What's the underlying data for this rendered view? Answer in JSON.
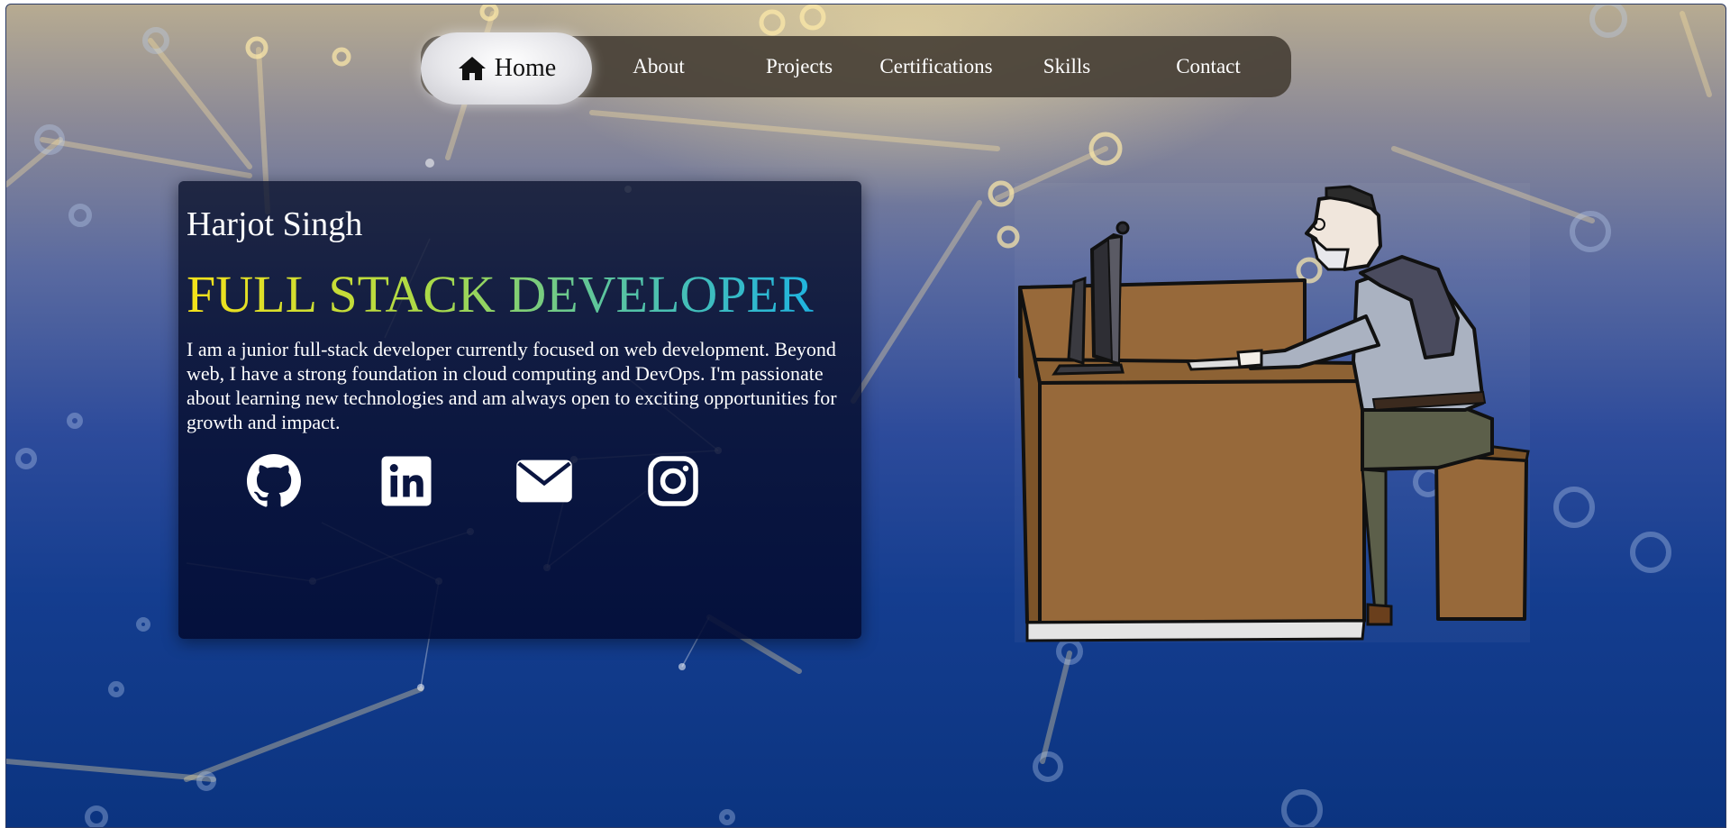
{
  "nav": {
    "items": [
      {
        "label": "Home",
        "icon": "home-icon"
      },
      {
        "label": "About"
      },
      {
        "label": "Projects"
      },
      {
        "label": "Certifications"
      },
      {
        "label": "Skills"
      },
      {
        "label": "Contact"
      }
    ]
  },
  "hero": {
    "name": "Harjot Singh",
    "title": "FULL STACK DEVELOPER",
    "description": "I am a junior full-stack developer currently focused on web development. Beyond web, I have a strong foundation in cloud computing and DevOps. I'm passionate about learning new technologies and am always open to exciting opportunities for growth and impact."
  },
  "social": [
    {
      "icon": "github-icon"
    },
    {
      "icon": "linkedin-icon"
    },
    {
      "icon": "envelope-icon"
    },
    {
      "icon": "instagram-icon"
    }
  ],
  "colors": {
    "title_gradient": [
      "#f5e21a",
      "#a8d94a",
      "#5fc59a",
      "#1fb4e0"
    ],
    "nav_bg": "#484036",
    "card_bg": "#0a1233"
  }
}
